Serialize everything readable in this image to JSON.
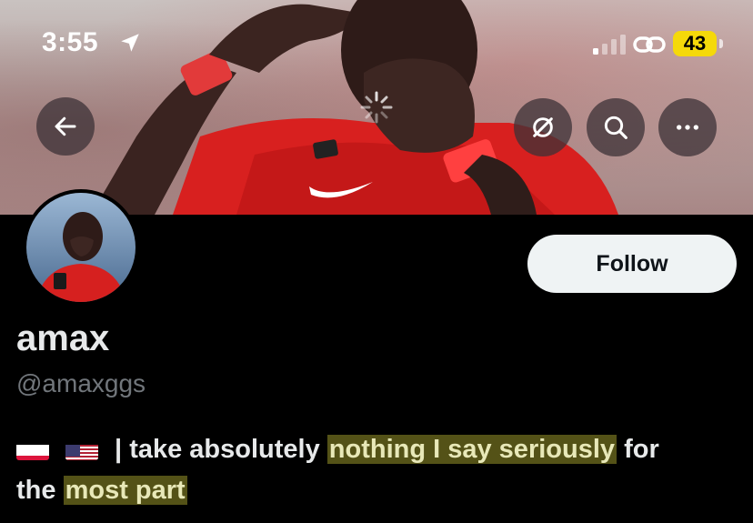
{
  "status_bar": {
    "time": "3:55",
    "battery": "43"
  },
  "header": {
    "back_icon": "arrow-left-icon",
    "actions": [
      "notification-off-icon",
      "search-icon",
      "more-icon"
    ]
  },
  "profile": {
    "display_name": "amax",
    "handle": "@amaxggs",
    "follow_label": "Follow",
    "bio": {
      "flags": [
        "poland-flag",
        "usa-flag"
      ],
      "separator": "|",
      "text_1": "take absolutely ",
      "text_hl_1": "nothing I say seriously",
      "text_2": " for",
      "text_3": "the ",
      "text_hl_2": "most part"
    }
  },
  "colors": {
    "background": "#000000",
    "follow_bg": "#eff3f4",
    "handle": "#71767b",
    "highlight": "#dcd73c",
    "battery": "#f5d90a"
  }
}
